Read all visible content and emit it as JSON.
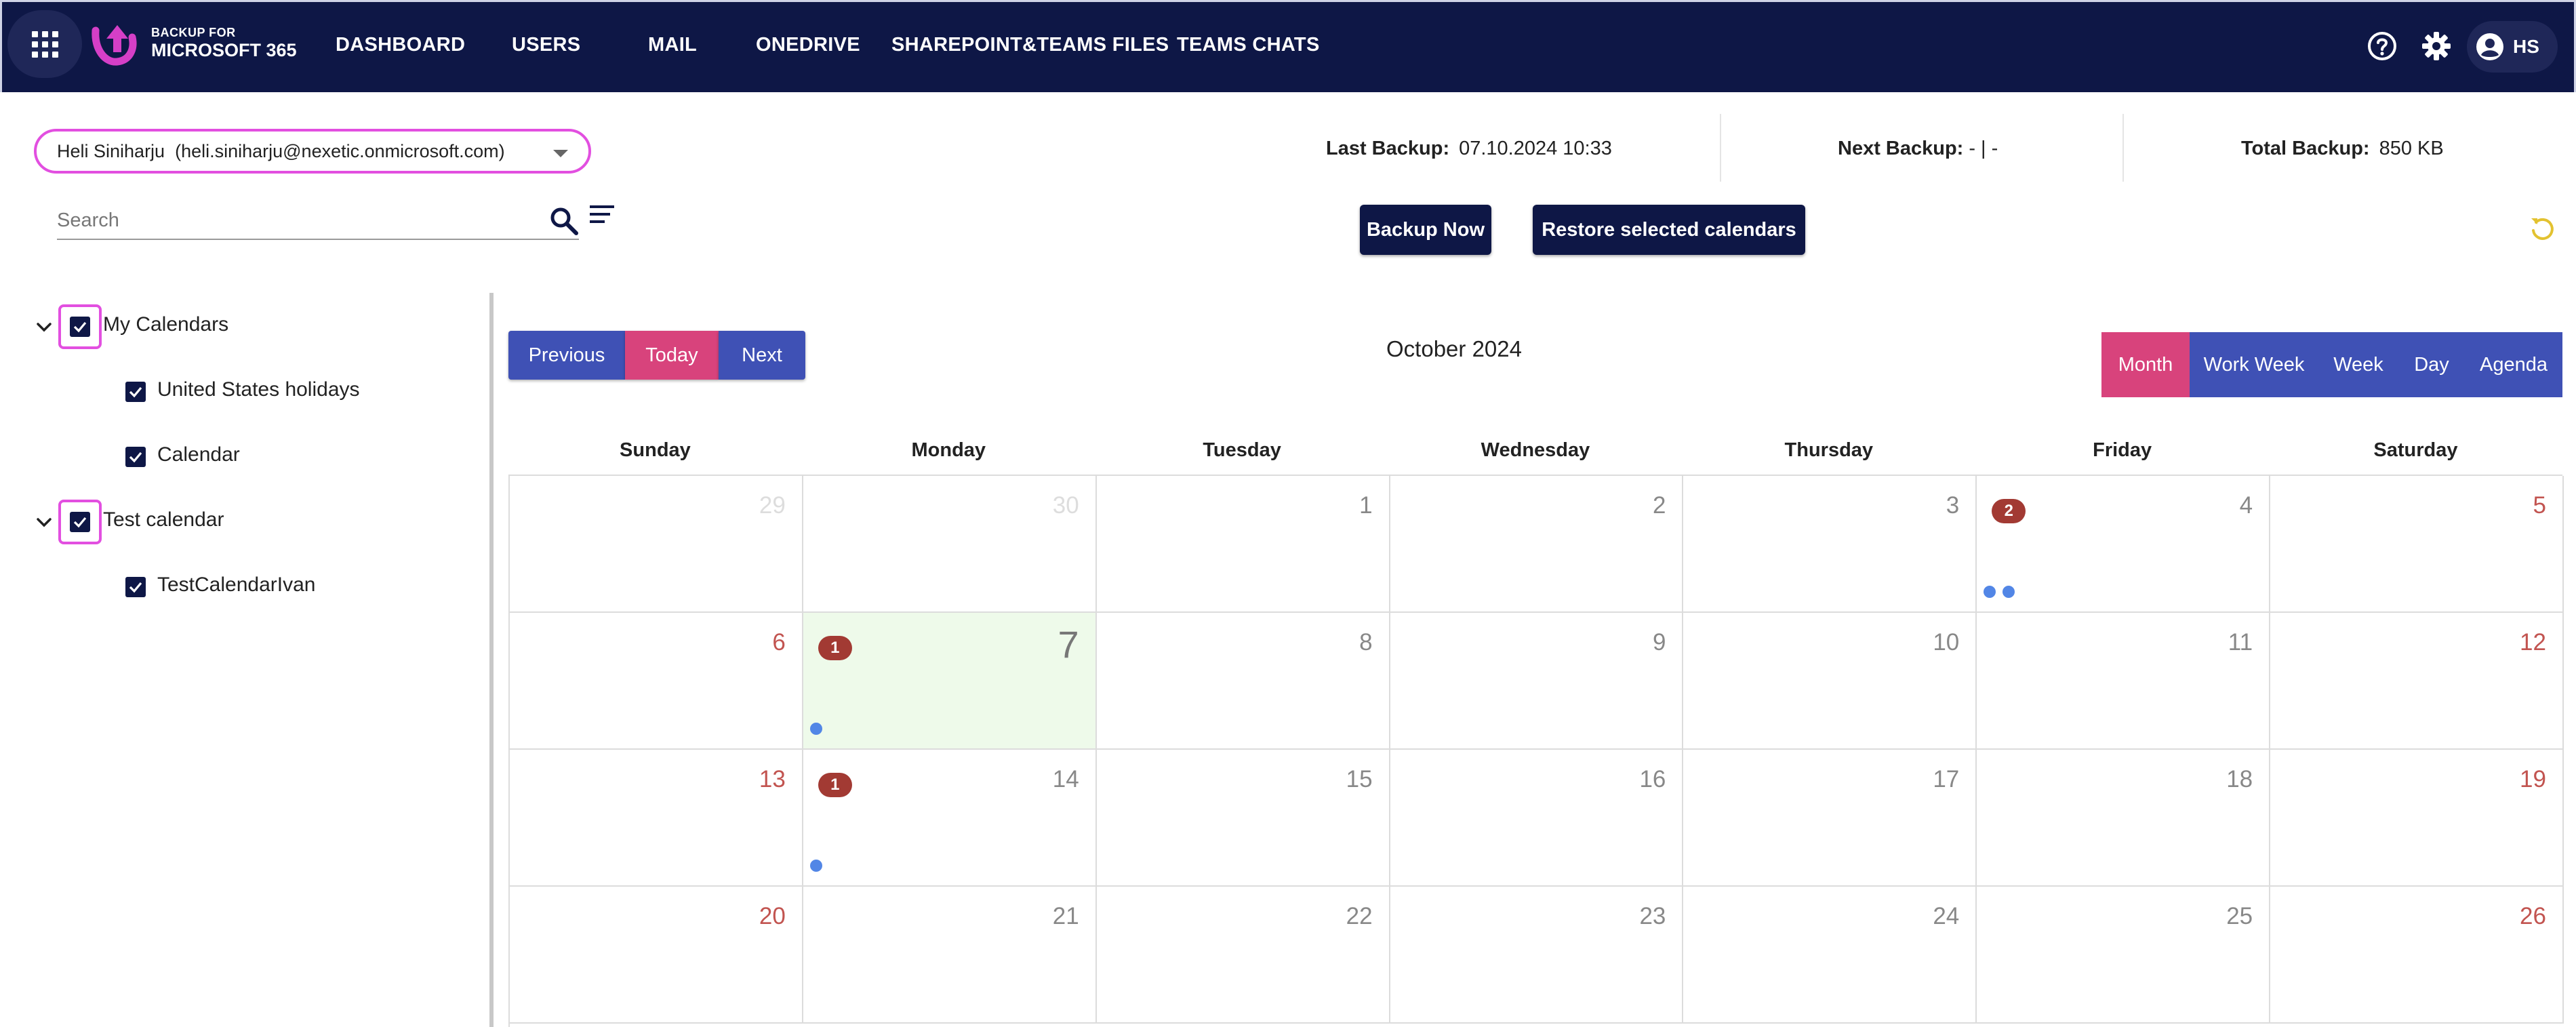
{
  "brand": {
    "line1": "BACKUP FOR",
    "line2": "MICROSOFT 365"
  },
  "nav": [
    "DASHBOARD",
    "USERS",
    "MAIL",
    "ONEDRIVE",
    "SHAREPOINT&TEAMS FILES",
    "TEAMS CHATS"
  ],
  "user": {
    "initials": "HS"
  },
  "account": {
    "selected": "Heli Siniharju  (heli.siniharju@nexetic.onmicrosoft.com)"
  },
  "stats": {
    "last_label": "Last Backup:",
    "last_value": "07.10.2024 10:33",
    "next_label": "Next Backup:",
    "next_value": "- | -",
    "total_label": "Total Backup:",
    "total_value": "850 KB"
  },
  "search": {
    "placeholder": "Search",
    "value": ""
  },
  "actions": {
    "backup_now": "Backup Now",
    "restore": "Restore selected calendars"
  },
  "tree": [
    {
      "label": "My Calendars",
      "checked": true,
      "expanded": true,
      "children": [
        {
          "label": "United States holidays",
          "checked": true
        },
        {
          "label": "Calendar",
          "checked": true
        }
      ]
    },
    {
      "label": "Test calendar",
      "checked": true,
      "expanded": true,
      "children": [
        {
          "label": "TestCalendarIvan",
          "checked": true
        }
      ]
    }
  ],
  "toolbar": {
    "previous": "Previous",
    "today": "Today",
    "next": "Next",
    "title": "October 2024"
  },
  "views": [
    "Month",
    "Work Week",
    "Week",
    "Day",
    "Agenda"
  ],
  "active_view": "Month",
  "weekdays": [
    "Sunday",
    "Monday",
    "Tuesday",
    "Wednesday",
    "Thursday",
    "Friday",
    "Saturday"
  ],
  "weeks": [
    [
      {
        "day": "29",
        "other": true
      },
      {
        "day": "30",
        "other": true
      },
      {
        "day": "1"
      },
      {
        "day": "2"
      },
      {
        "day": "3"
      },
      {
        "day": "4",
        "badge": "2",
        "dots": 2
      },
      {
        "day": "5"
      }
    ],
    [
      {
        "day": "6"
      },
      {
        "day": "7",
        "today": true,
        "badge": "1",
        "dots": 1
      },
      {
        "day": "8"
      },
      {
        "day": "9"
      },
      {
        "day": "10"
      },
      {
        "day": "11"
      },
      {
        "day": "12"
      }
    ],
    [
      {
        "day": "13"
      },
      {
        "day": "14",
        "badge": "1",
        "dots": 1
      },
      {
        "day": "15"
      },
      {
        "day": "16"
      },
      {
        "day": "17"
      },
      {
        "day": "18"
      },
      {
        "day": "19"
      }
    ],
    [
      {
        "day": "20"
      },
      {
        "day": "21"
      },
      {
        "day": "22"
      },
      {
        "day": "23"
      },
      {
        "day": "24"
      },
      {
        "day": "25"
      },
      {
        "day": "26"
      }
    ]
  ],
  "colors": {
    "nav_bg": "#0e1746",
    "accent_pink": "#d8437c",
    "primary_blue": "#3f51b5",
    "weekend_red": "#c25450",
    "badge_red": "#a23a33",
    "event_dot": "#5286e6",
    "today_bg": "#eefaea",
    "highlight_outline": "#e24fe0"
  }
}
